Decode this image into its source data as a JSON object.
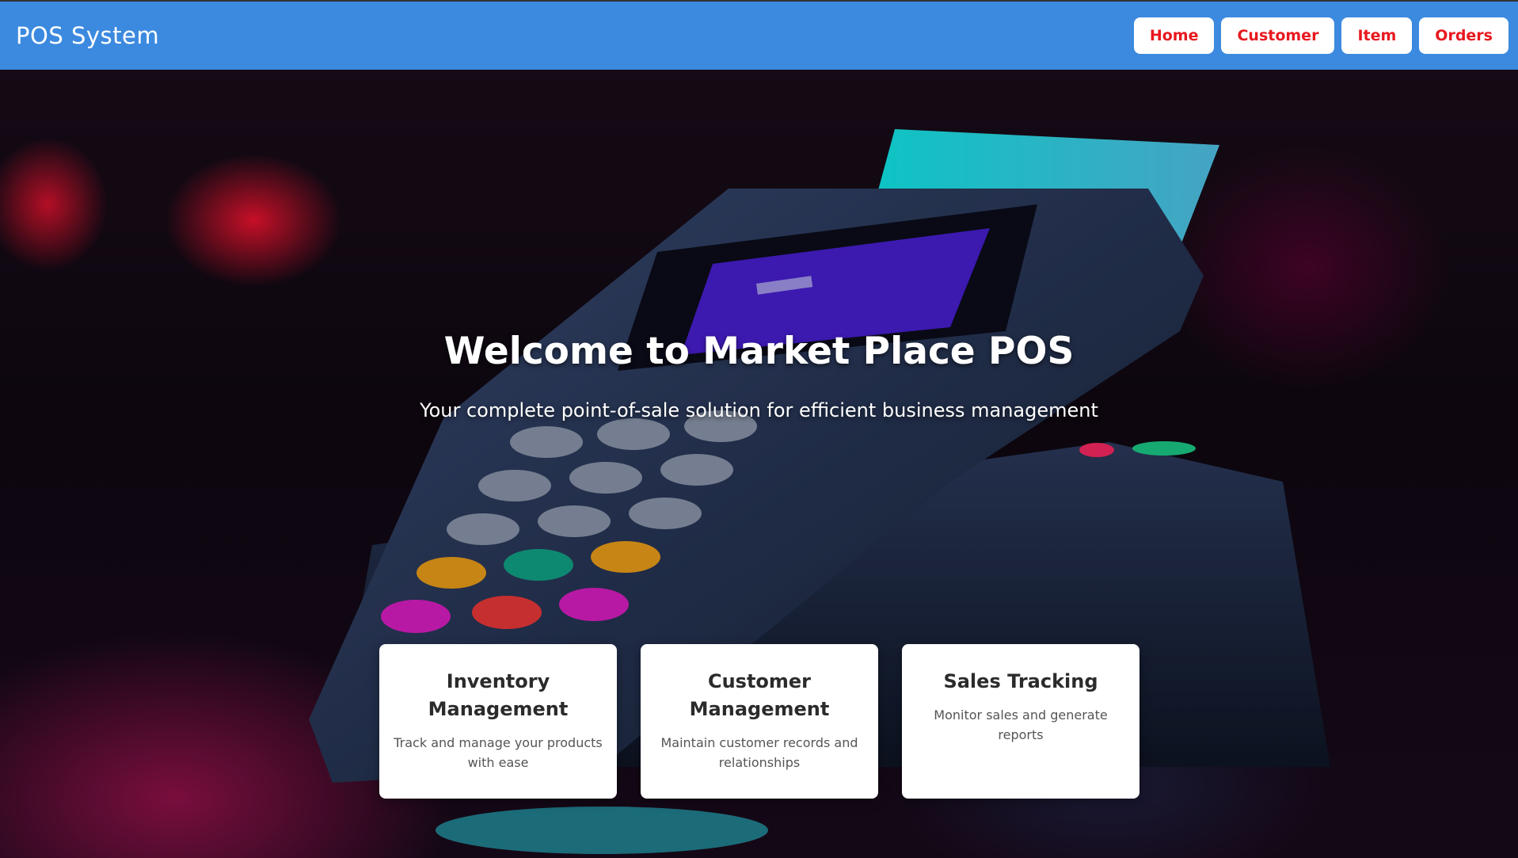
{
  "app": {
    "brand": "POS System"
  },
  "nav": {
    "items": [
      {
        "label": "Home"
      },
      {
        "label": "Customer"
      },
      {
        "label": "Item"
      },
      {
        "label": "Orders"
      }
    ]
  },
  "hero": {
    "title": "Welcome to Market Place POS",
    "subtitle": "Your complete point-of-sale solution for efficient business management",
    "background_image": "pos-terminal-photo"
  },
  "features": [
    {
      "title": "Inventory Management",
      "description": "Track and manage your products with ease"
    },
    {
      "title": "Customer Management",
      "description": "Maintain customer records and relationships"
    },
    {
      "title": "Sales Tracking",
      "description": "Monitor sales and generate reports"
    }
  ],
  "colors": {
    "navbar": "#3c8adf",
    "nav_button_text": "#e8181f",
    "nav_button_bg": "#ffffff",
    "card_bg": "#ffffff"
  }
}
